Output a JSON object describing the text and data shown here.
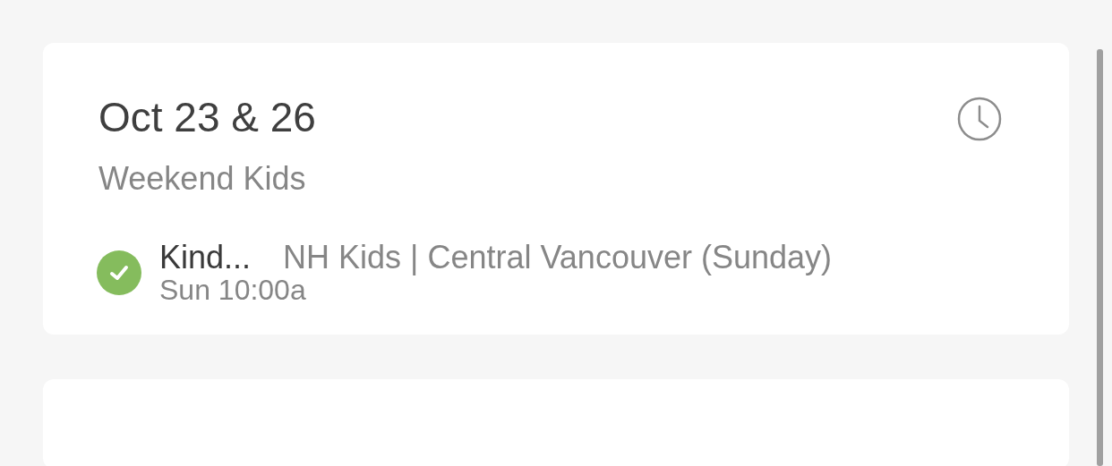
{
  "cards": [
    {
      "date": "Oct 23 & 26",
      "group": "Weekend Kids",
      "assignments": [
        {
          "position": "Kind...",
          "team": "NH Kids | Central Vancouver (Sunday)",
          "time": "Sun 10:00a",
          "confirmed": true
        }
      ]
    }
  ]
}
